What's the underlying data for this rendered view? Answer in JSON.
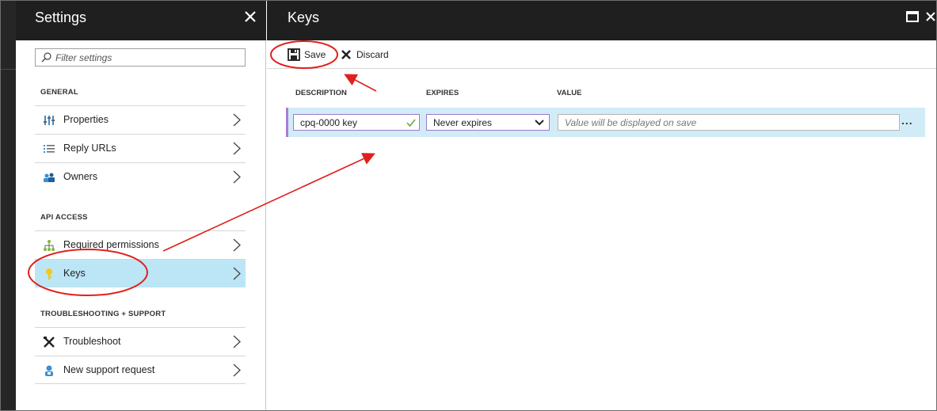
{
  "settings": {
    "title": "Settings",
    "filter_placeholder": "Filter settings",
    "sections": {
      "general": "GENERAL",
      "api_access": "API ACCESS",
      "troubleshooting": "TROUBLESHOOTING + SUPPORT"
    },
    "items": {
      "properties": "Properties",
      "reply_urls": "Reply URLs",
      "owners": "Owners",
      "required_permissions": "Required permissions",
      "keys": "Keys",
      "troubleshoot": "Troubleshoot",
      "new_support_request": "New support request"
    },
    "selected_item": "keys"
  },
  "keys_blade": {
    "title": "Keys",
    "toolbar": {
      "save_label": "Save",
      "discard_label": "Discard"
    },
    "columns": {
      "description": "DESCRIPTION",
      "expires": "EXPIRES",
      "value": "VALUE"
    },
    "row": {
      "description": "cpq-0000 key",
      "expires": "Never expires",
      "value_placeholder": "Value will be displayed on save",
      "more": "..."
    }
  },
  "colors": {
    "header_bg": "#1f1f1f",
    "selected_bg": "#bce6f5",
    "row_bg": "#d2ecf7",
    "row_accent": "#a97bd4",
    "annotation_red": "#e0201c"
  }
}
